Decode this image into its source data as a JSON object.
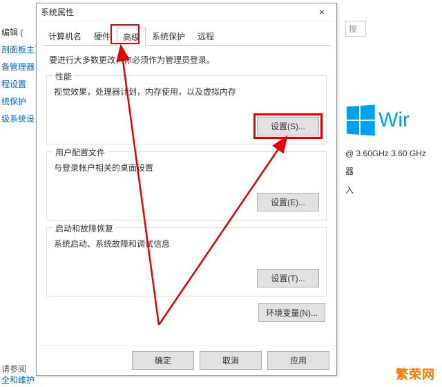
{
  "bg": {
    "left_links": [
      "编辑 (",
      "剖面板主页",
      "备管理器",
      "程设置",
      "统保护",
      "级系统设",
      "请参阅",
      "全和维护"
    ],
    "search_placeholder": "搜",
    "win_text": "Wir",
    "ghz": "@ 3.60GHz   3.60 GHz",
    "other1": "器",
    "other2": "入"
  },
  "dialog": {
    "title": "系统属性",
    "close": "×",
    "tabs": [
      "计算机名",
      "硬件",
      "高级",
      "系统保护",
      "远程"
    ],
    "active_tab": 2,
    "admin_note": "要进行大多数更改，你必须作为管理员登录。",
    "groups": [
      {
        "legend": "性能",
        "desc": "视觉效果，处理器计划，内存使用，以及虚拟内存",
        "button": "设置(S)...",
        "highlight": true
      },
      {
        "legend": "用户配置文件",
        "desc": "与登录帐户相关的桌面设置",
        "button": "设置(E)..."
      },
      {
        "legend": "启动和故障恢复",
        "desc": "系统启动、系统故障和调试信息",
        "button": "设置(T)..."
      }
    ],
    "env_button": "环境变量(N)...",
    "footer": {
      "ok": "确定",
      "cancel": "取消",
      "apply": "应用"
    }
  },
  "watermark": "繁荣网"
}
